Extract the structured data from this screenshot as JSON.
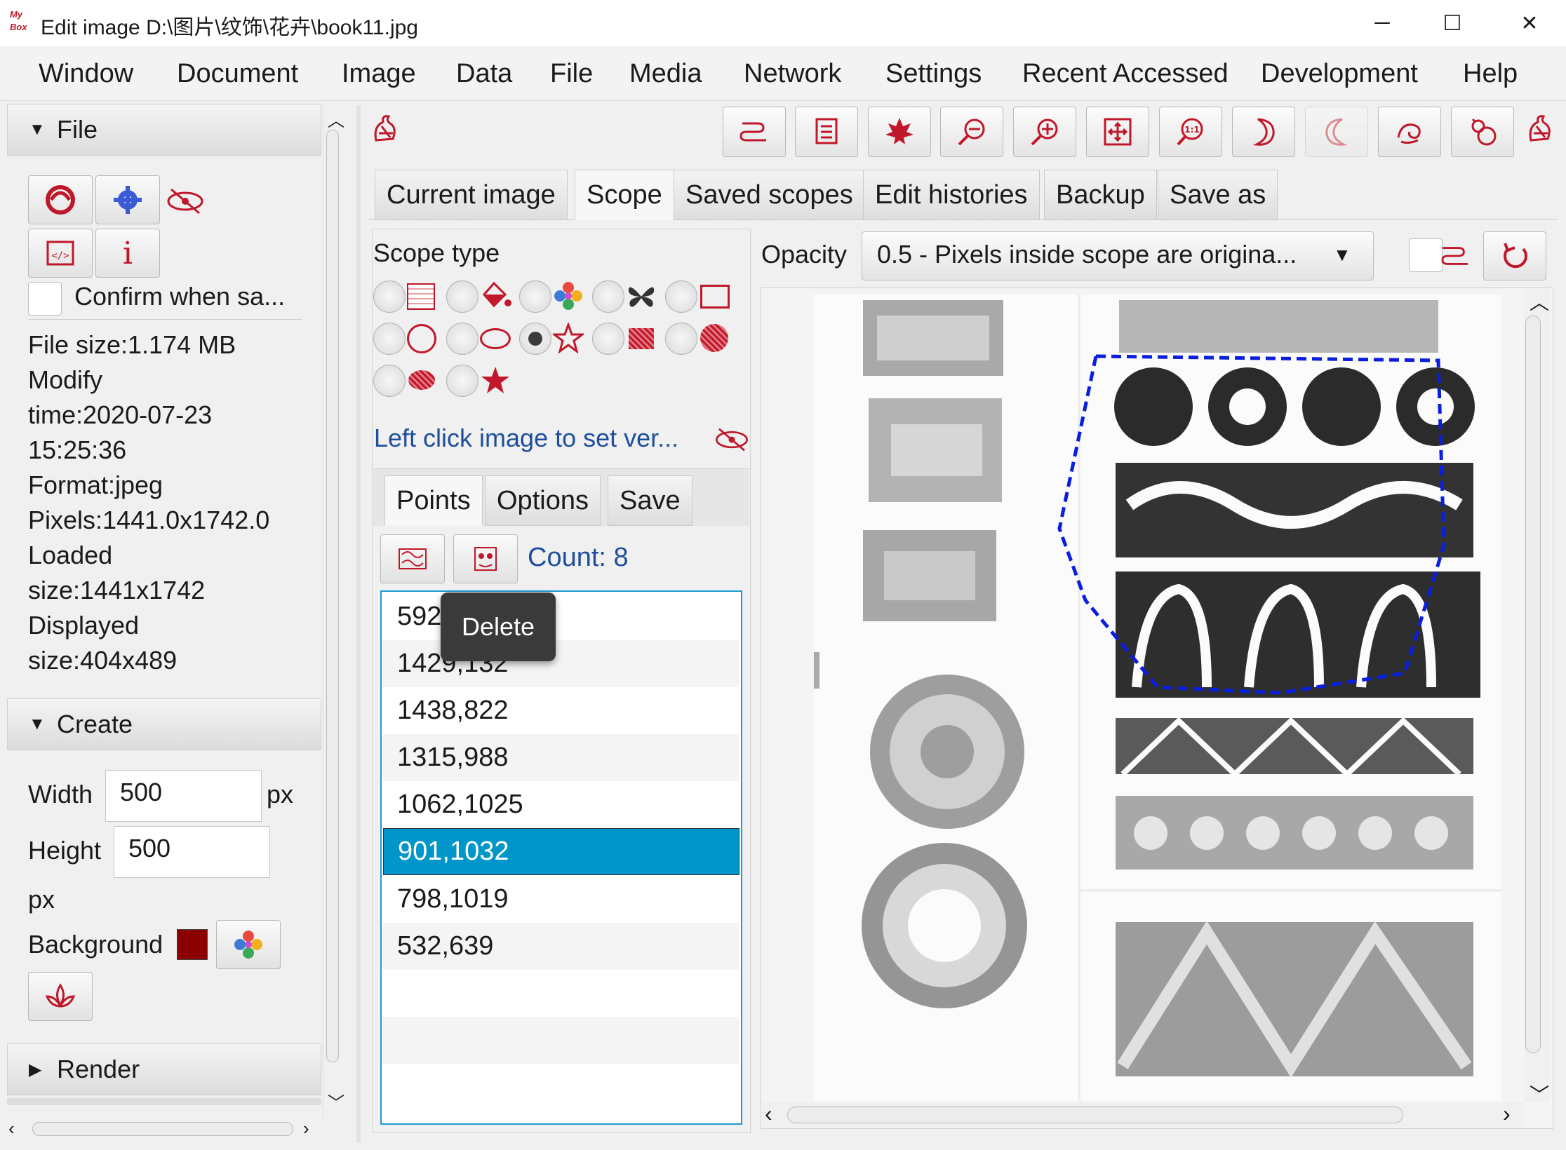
{
  "window": {
    "title": "Edit image D:\\图片\\纹饰\\花卉\\book11.jpg",
    "logo": "My Box",
    "minimize": "─",
    "maximize": "☐",
    "close": "✕"
  },
  "menu": [
    "Window",
    "Document",
    "Image",
    "Data",
    "File",
    "Media",
    "Network",
    "Settings",
    "Recent Accessed",
    "Development",
    "Help"
  ],
  "left": {
    "file_section": "File",
    "confirm_label": "Confirm when sa...",
    "info": [
      "File size:1.174 MB",
      "Modify",
      "time:2020-07-23",
      "15:25:36",
      "Format:jpeg",
      "Pixels:1441.0x1742.0",
      "Loaded",
      "size:1441x1742",
      "Displayed",
      "size:404x489"
    ],
    "create_section": "Create",
    "width_label": "Width",
    "width_value": "500",
    "width_unit": "px",
    "height_label": "Height",
    "height_value": "500",
    "height_unit": "px",
    "background_label": "Background",
    "background_color": "#8b0000",
    "render_section": "Render"
  },
  "tabs": [
    "Current image",
    "Scope",
    "Saved scopes",
    "Edit histories",
    "Backup",
    "Save as"
  ],
  "scope": {
    "title": "Scope type",
    "hint": "Left click image to set ver..."
  },
  "subtabs": [
    "Points",
    "Options",
    "Save"
  ],
  "count": "Count: 8",
  "points": [
    "592,119",
    "1429,132",
    "1438,822",
    "1315,988",
    "1062,1025",
    "901,1032",
    "798,1019",
    "532,639"
  ],
  "selected_point": "901,1032",
  "tooltip": "Delete",
  "opacity": {
    "label": "Opacity",
    "value": "0.5 - Pixels inside scope are origina..."
  },
  "colors": {
    "accent": "#0096c9",
    "icon_red": "#c0182a",
    "scope_line": "#0a1ee0"
  }
}
